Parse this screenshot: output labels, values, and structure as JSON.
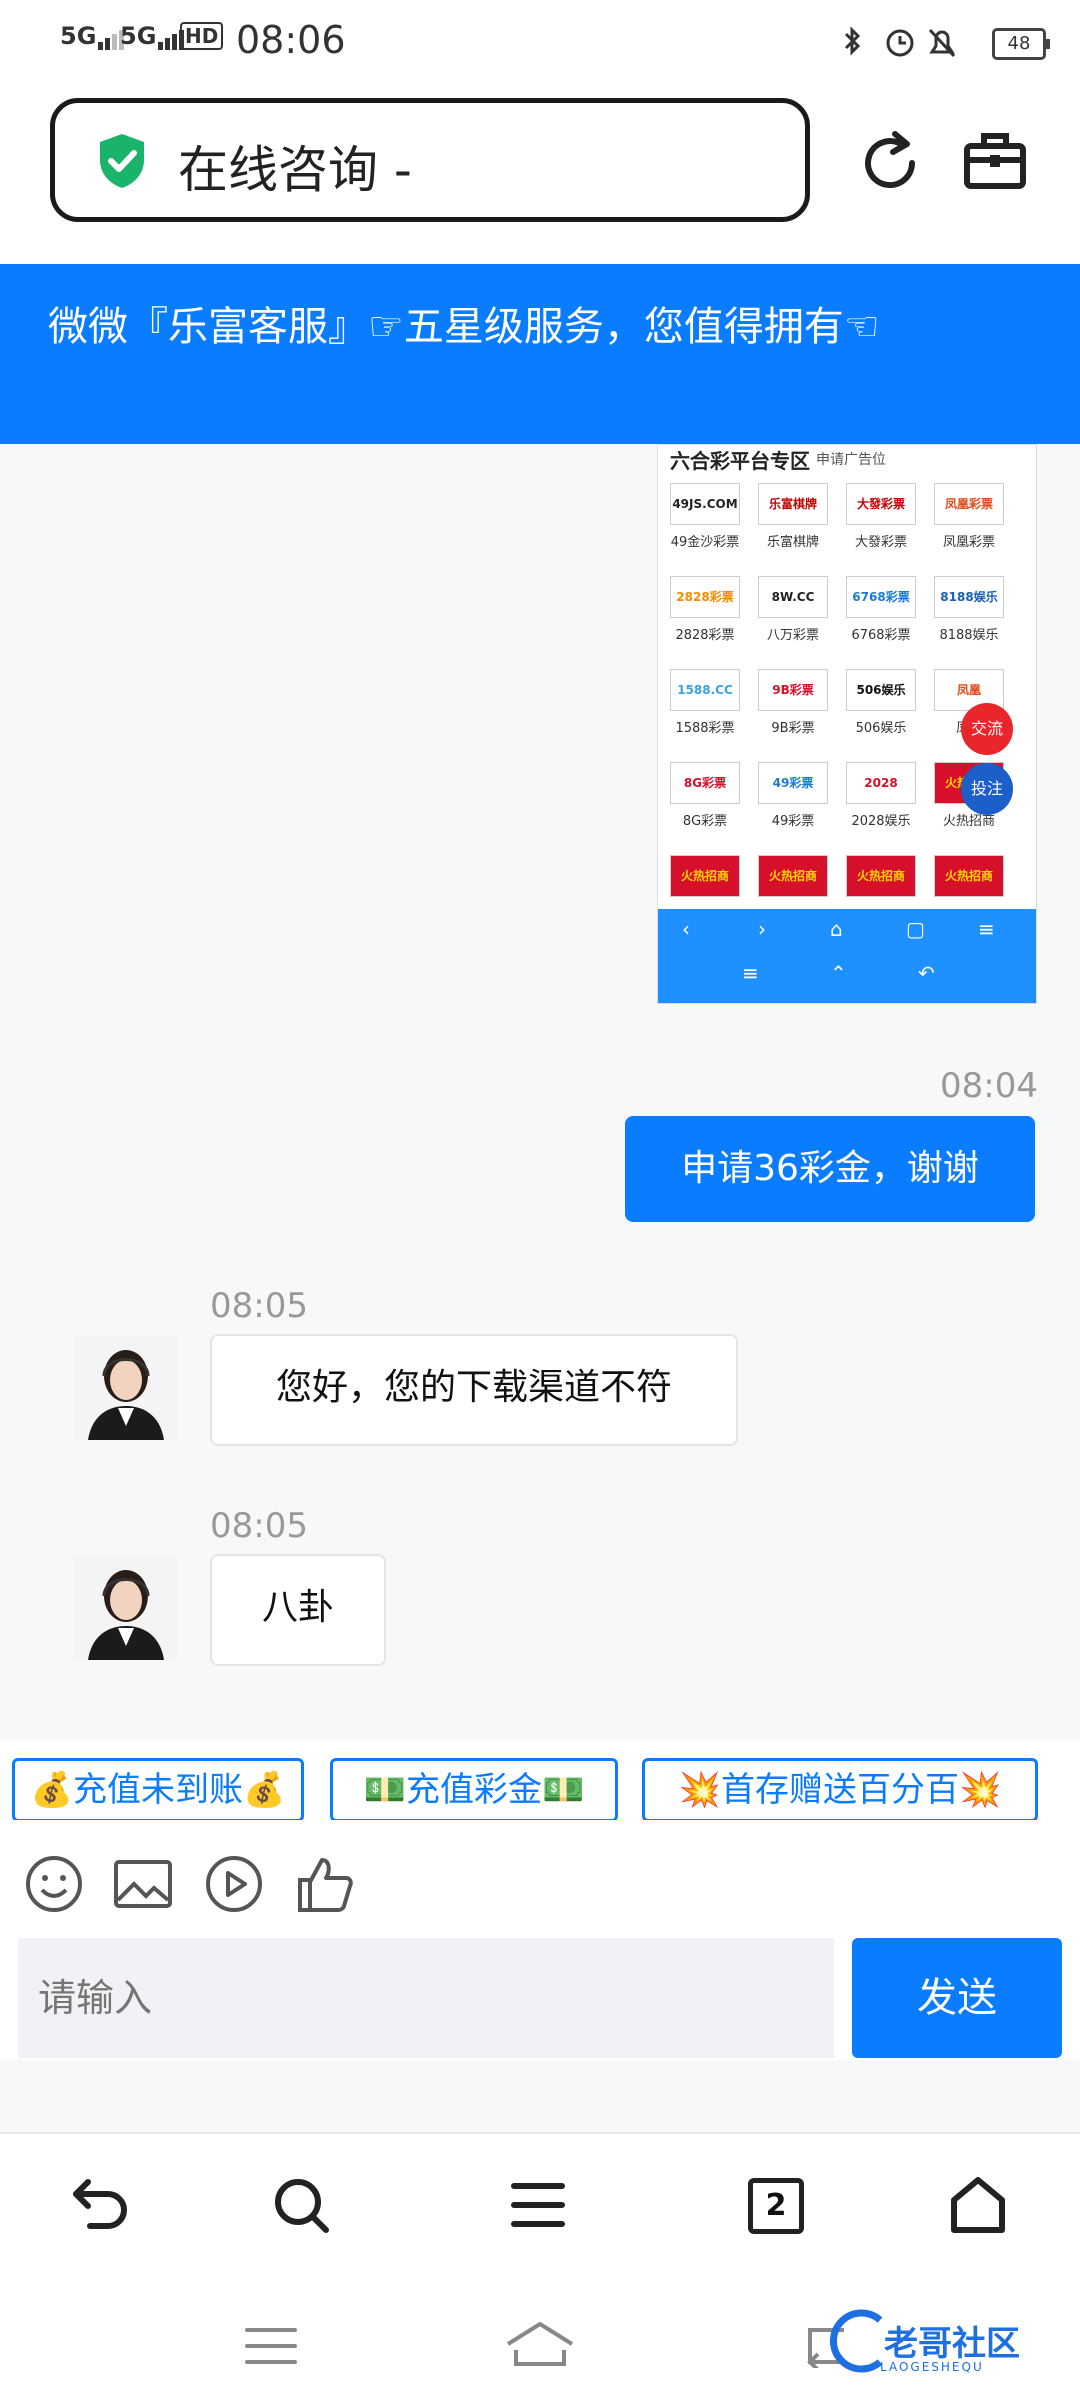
{
  "status_bar": {
    "net1": "5G",
    "net2": "5G",
    "hd": "HD",
    "time": "08:06",
    "battery": "48"
  },
  "header": {
    "title": "在线咨询 -"
  },
  "banner": {
    "text": "微微『乐富客服』☞五星级服务，您值得拥有☜"
  },
  "shared_image": {
    "title": "六合彩平台专区",
    "subtitle": "申请广告位",
    "tiles": [
      {
        "logo": "49JS.COM",
        "caption": "49金沙彩票"
      },
      {
        "logo": "乐富棋牌",
        "caption": "乐富棋牌"
      },
      {
        "logo": "大發彩票",
        "caption": "大發彩票"
      },
      {
        "logo": "凤凰彩票",
        "caption": "凤凰彩票"
      },
      {
        "logo": "2828彩票",
        "caption": "2828彩票"
      },
      {
        "logo": "8W.CC",
        "caption": "八万彩票"
      },
      {
        "logo": "6768彩票",
        "caption": "6768彩票"
      },
      {
        "logo": "8188娱乐",
        "caption": "8188娱乐"
      },
      {
        "logo": "1588.CC",
        "caption": "1588彩票"
      },
      {
        "logo": "9B彩票",
        "caption": "9B彩票"
      },
      {
        "logo": "506娱乐",
        "caption": "506娱乐"
      },
      {
        "logo": "凤凰",
        "caption": "凤凰"
      },
      {
        "logo": "8G彩票",
        "caption": "8G彩票"
      },
      {
        "logo": "49彩票",
        "caption": "49彩票"
      },
      {
        "logo": "2028",
        "caption": "2028娱乐"
      },
      {
        "logo": "火热招商",
        "caption": "火热招商"
      },
      {
        "logo": "火热招商",
        "caption": ""
      },
      {
        "logo": "火热招商",
        "caption": ""
      },
      {
        "logo": "火热招商",
        "caption": ""
      },
      {
        "logo": "火热招商",
        "caption": ""
      }
    ],
    "fab_chat": "交流",
    "fab_bet": "投注"
  },
  "messages": [
    {
      "time": "08:04",
      "text": "申请36彩金，谢谢",
      "from": "me"
    },
    {
      "time": "08:05",
      "text": "您好，您的下载渠道不符",
      "from": "agent"
    },
    {
      "time": "08:05",
      "text": "八卦",
      "from": "agent"
    }
  ],
  "quick_buttons": [
    "💰充值未到账💰",
    "💵充值彩金💵",
    "💥首存赠送百分百💥"
  ],
  "composer": {
    "placeholder": "请输入",
    "send_label": "发送"
  },
  "browser_nav": {
    "tabs_count": "2"
  },
  "watermark": {
    "text": "老哥社区",
    "sub": "LAOGESHEQU"
  },
  "colors": {
    "accent": "#0a7cff",
    "shield": "#19b36b"
  }
}
